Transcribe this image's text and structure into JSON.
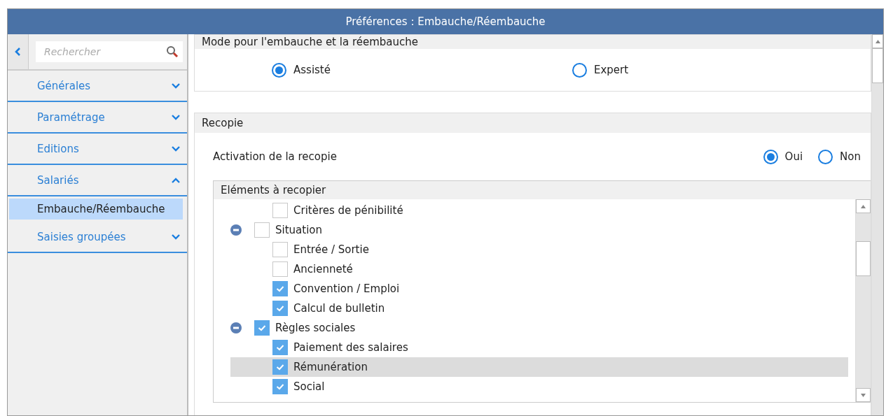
{
  "window": {
    "title": "Préférences : Embauche/Réembauche"
  },
  "sidebar": {
    "search": {
      "placeholder": "Rechercher"
    },
    "items": [
      {
        "label": "Générales",
        "expanded": false
      },
      {
        "label": "Paramétrage",
        "expanded": false
      },
      {
        "label": "Editions",
        "expanded": false
      },
      {
        "label": "Salariés",
        "expanded": true,
        "children": [
          {
            "label": "Embauche/Réembauche",
            "selected": true
          }
        ]
      },
      {
        "label": "Saisies groupées",
        "expanded": false
      }
    ]
  },
  "mode": {
    "title": "Mode pour l'embauche et la réembauche",
    "options": [
      {
        "label": "Assisté",
        "selected": true
      },
      {
        "label": "Expert",
        "selected": false
      }
    ]
  },
  "recopie": {
    "title": "Recopie",
    "activation": {
      "label": "Activation de la recopie",
      "options": [
        {
          "label": "Oui",
          "selected": true
        },
        {
          "label": "Non",
          "selected": false
        }
      ]
    },
    "tree": {
      "title": "Eléments à recopier",
      "items": [
        {
          "children": [
            {
              "label": "Critères de pénibilité",
              "checked": false,
              "selected": false
            }
          ]
        },
        {
          "label": "Situation",
          "checked": false,
          "selected": false,
          "expanded": true,
          "children": [
            {
              "label": "Entrée / Sortie",
              "checked": false,
              "selected": false
            },
            {
              "label": "Ancienneté",
              "checked": false,
              "selected": false
            },
            {
              "label": "Convention / Emploi",
              "checked": true,
              "selected": false
            },
            {
              "label": "Calcul de bulletin",
              "checked": true,
              "selected": false
            }
          ]
        },
        {
          "label": "Règles sociales",
          "checked": true,
          "selected": false,
          "expanded": true,
          "children": [
            {
              "label": "Paiement des salaires",
              "checked": true,
              "selected": false
            },
            {
              "label": "Rémunération",
              "checked": true,
              "selected": true
            },
            {
              "label": "Social",
              "checked": true,
              "selected": false
            }
          ]
        }
      ]
    }
  }
}
